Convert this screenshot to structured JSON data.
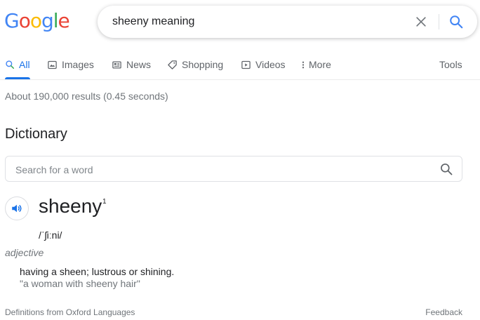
{
  "logo": {
    "letters": [
      "G",
      "o",
      "o",
      "g",
      "l",
      "e"
    ],
    "colors": [
      "#4285F4",
      "#EA4335",
      "#FBBC05",
      "#4285F4",
      "#34A853",
      "#EA4335"
    ]
  },
  "search": {
    "query": "sheeny meaning",
    "clear_icon": "close-icon",
    "submit_icon": "search-icon"
  },
  "tabs": [
    {
      "label": "All",
      "icon": "search-icon",
      "active": true
    },
    {
      "label": "Images",
      "icon": "image-icon",
      "active": false
    },
    {
      "label": "News",
      "icon": "news-icon",
      "active": false
    },
    {
      "label": "Shopping",
      "icon": "tag-icon",
      "active": false
    },
    {
      "label": "Videos",
      "icon": "play-icon",
      "active": false
    },
    {
      "label": "More",
      "icon": "dots-vertical-icon",
      "active": false
    }
  ],
  "tools_label": "Tools",
  "result_stats": "About 190,000 results (0.45 seconds)",
  "dictionary": {
    "title": "Dictionary",
    "search_placeholder": "Search for a word",
    "word": "sheeny",
    "superscript": "1",
    "phonetic": "/ˈʃiːni/",
    "part_of_speech": "adjective",
    "definition": "having a sheen; lustrous or shining.",
    "example": "\"a woman with sheeny hair\"",
    "audio_icon": "speaker-icon"
  },
  "footer": {
    "source": "Definitions from Oxford Languages",
    "feedback": "Feedback"
  },
  "colors": {
    "accent_blue": "#1a73e8",
    "text_primary": "#202124",
    "text_secondary": "#70757a",
    "icon_grey": "#5f6368"
  }
}
